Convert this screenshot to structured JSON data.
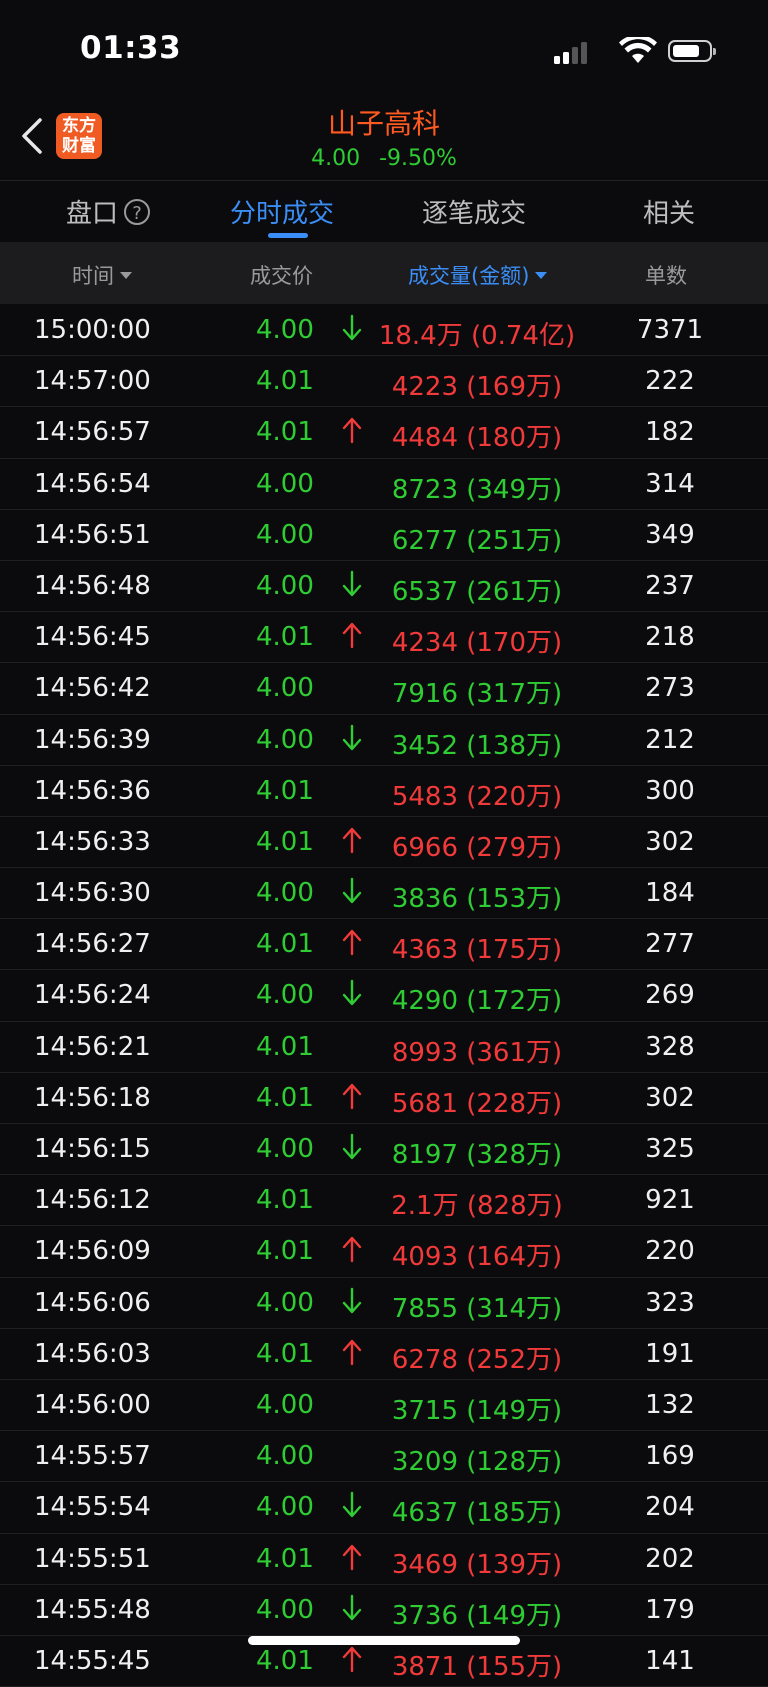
{
  "status_bar": {
    "time": "01:33"
  },
  "header": {
    "logo_line1": "东方",
    "logo_line2": "财富",
    "stock_name": "山子高科",
    "price": "4.00",
    "change_pct": "-9.50%"
  },
  "tabs": [
    {
      "label": "盘口",
      "active": false
    },
    {
      "label": "分时成交",
      "active": true
    },
    {
      "label": "逐笔成交",
      "active": false
    },
    {
      "label": "相关",
      "active": false
    }
  ],
  "columns": {
    "time": "时间",
    "price": "成交价",
    "volume": "成交量(金额)",
    "count": "单数"
  },
  "colors": {
    "up": "#f23a3a",
    "down": "#2fcd34",
    "accent": "#3a8ef6",
    "brand": "#f05a23"
  },
  "trades": [
    {
      "time": "15:00:00",
      "price": "4.00",
      "price_dir": "down",
      "arrow": "down",
      "volume": "18.4万 (0.74亿)",
      "vol_dir": "up",
      "count": "7371"
    },
    {
      "time": "14:57:00",
      "price": "4.01",
      "price_dir": "down",
      "arrow": "",
      "volume": "4223 (169万)",
      "vol_dir": "up",
      "count": "222"
    },
    {
      "time": "14:56:57",
      "price": "4.01",
      "price_dir": "down",
      "arrow": "up",
      "volume": "4484 (180万)",
      "vol_dir": "up",
      "count": "182"
    },
    {
      "time": "14:56:54",
      "price": "4.00",
      "price_dir": "down",
      "arrow": "",
      "volume": "8723 (349万)",
      "vol_dir": "down",
      "count": "314"
    },
    {
      "time": "14:56:51",
      "price": "4.00",
      "price_dir": "down",
      "arrow": "",
      "volume": "6277 (251万)",
      "vol_dir": "down",
      "count": "349"
    },
    {
      "time": "14:56:48",
      "price": "4.00",
      "price_dir": "down",
      "arrow": "down",
      "volume": "6537 (261万)",
      "vol_dir": "down",
      "count": "237"
    },
    {
      "time": "14:56:45",
      "price": "4.01",
      "price_dir": "down",
      "arrow": "up",
      "volume": "4234 (170万)",
      "vol_dir": "up",
      "count": "218"
    },
    {
      "time": "14:56:42",
      "price": "4.00",
      "price_dir": "down",
      "arrow": "",
      "volume": "7916 (317万)",
      "vol_dir": "down",
      "count": "273"
    },
    {
      "time": "14:56:39",
      "price": "4.00",
      "price_dir": "down",
      "arrow": "down",
      "volume": "3452 (138万)",
      "vol_dir": "down",
      "count": "212"
    },
    {
      "time": "14:56:36",
      "price": "4.01",
      "price_dir": "down",
      "arrow": "",
      "volume": "5483 (220万)",
      "vol_dir": "up",
      "count": "300"
    },
    {
      "time": "14:56:33",
      "price": "4.01",
      "price_dir": "down",
      "arrow": "up",
      "volume": "6966 (279万)",
      "vol_dir": "up",
      "count": "302"
    },
    {
      "time": "14:56:30",
      "price": "4.00",
      "price_dir": "down",
      "arrow": "down",
      "volume": "3836 (153万)",
      "vol_dir": "down",
      "count": "184"
    },
    {
      "time": "14:56:27",
      "price": "4.01",
      "price_dir": "down",
      "arrow": "up",
      "volume": "4363 (175万)",
      "vol_dir": "up",
      "count": "277"
    },
    {
      "time": "14:56:24",
      "price": "4.00",
      "price_dir": "down",
      "arrow": "down",
      "volume": "4290 (172万)",
      "vol_dir": "down",
      "count": "269"
    },
    {
      "time": "14:56:21",
      "price": "4.01",
      "price_dir": "down",
      "arrow": "",
      "volume": "8993 (361万)",
      "vol_dir": "up",
      "count": "328"
    },
    {
      "time": "14:56:18",
      "price": "4.01",
      "price_dir": "down",
      "arrow": "up",
      "volume": "5681 (228万)",
      "vol_dir": "up",
      "count": "302"
    },
    {
      "time": "14:56:15",
      "price": "4.00",
      "price_dir": "down",
      "arrow": "down",
      "volume": "8197 (328万)",
      "vol_dir": "down",
      "count": "325"
    },
    {
      "time": "14:56:12",
      "price": "4.01",
      "price_dir": "down",
      "arrow": "",
      "volume": "2.1万 (828万)",
      "vol_dir": "up",
      "count": "921"
    },
    {
      "time": "14:56:09",
      "price": "4.01",
      "price_dir": "down",
      "arrow": "up",
      "volume": "4093 (164万)",
      "vol_dir": "up",
      "count": "220"
    },
    {
      "time": "14:56:06",
      "price": "4.00",
      "price_dir": "down",
      "arrow": "down",
      "volume": "7855 (314万)",
      "vol_dir": "down",
      "count": "323"
    },
    {
      "time": "14:56:03",
      "price": "4.01",
      "price_dir": "down",
      "arrow": "up",
      "volume": "6278 (252万)",
      "vol_dir": "up",
      "count": "191"
    },
    {
      "time": "14:56:00",
      "price": "4.00",
      "price_dir": "down",
      "arrow": "",
      "volume": "3715 (149万)",
      "vol_dir": "down",
      "count": "132"
    },
    {
      "time": "14:55:57",
      "price": "4.00",
      "price_dir": "down",
      "arrow": "",
      "volume": "3209 (128万)",
      "vol_dir": "down",
      "count": "169"
    },
    {
      "time": "14:55:54",
      "price": "4.00",
      "price_dir": "down",
      "arrow": "down",
      "volume": "4637 (185万)",
      "vol_dir": "down",
      "count": "204"
    },
    {
      "time": "14:55:51",
      "price": "4.01",
      "price_dir": "down",
      "arrow": "up",
      "volume": "3469 (139万)",
      "vol_dir": "up",
      "count": "202"
    },
    {
      "time": "14:55:48",
      "price": "4.00",
      "price_dir": "down",
      "arrow": "down",
      "volume": "3736 (149万)",
      "vol_dir": "down",
      "count": "179"
    },
    {
      "time": "14:55:45",
      "price": "4.01",
      "price_dir": "down",
      "arrow": "up",
      "volume": "3871 (155万)",
      "vol_dir": "up",
      "count": "141"
    }
  ]
}
